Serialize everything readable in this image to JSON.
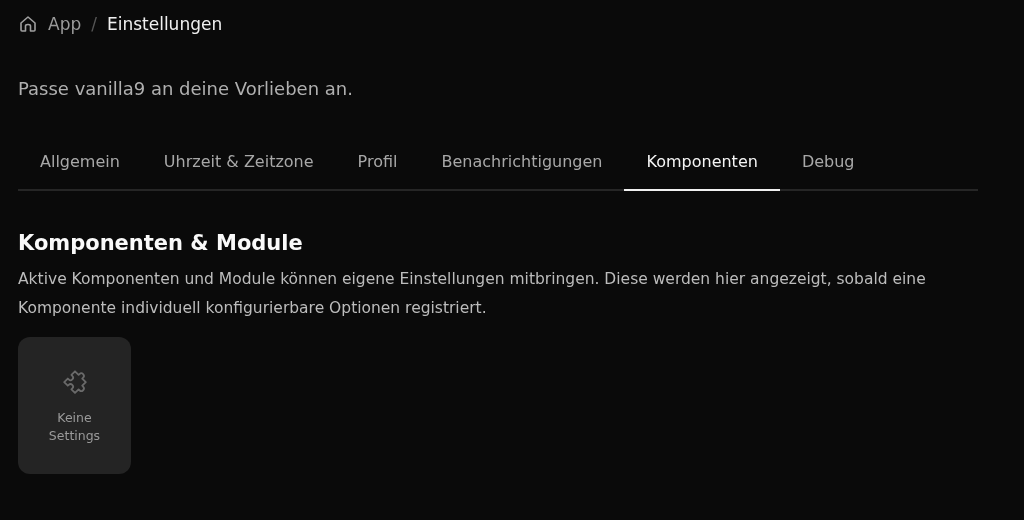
{
  "breadcrumb": [
    {
      "label": "App",
      "current": false
    },
    {
      "label": "Einstellungen",
      "current": true
    }
  ],
  "breadcrumb_separator": "/",
  "subtitle": "Passe vanilla9 an deine Vorlieben an.",
  "tabs": [
    {
      "label": "Allgemein",
      "selected": false
    },
    {
      "label": "Uhrzeit & Zeitzone",
      "selected": false
    },
    {
      "label": "Profil",
      "selected": false
    },
    {
      "label": "Benachrichtigungen",
      "selected": false
    },
    {
      "label": "Komponenten",
      "selected": true
    },
    {
      "label": "Debug",
      "selected": false
    }
  ],
  "section": {
    "title": "Komponenten & Module",
    "description": "Aktive Komponenten und Module können eigene Einstellungen mitbringen. Diese werden hier angezeigt, sobald eine Komponente individuell konfigurierbare Optionen registriert."
  },
  "empty_card": {
    "label": "Keine Settings"
  }
}
